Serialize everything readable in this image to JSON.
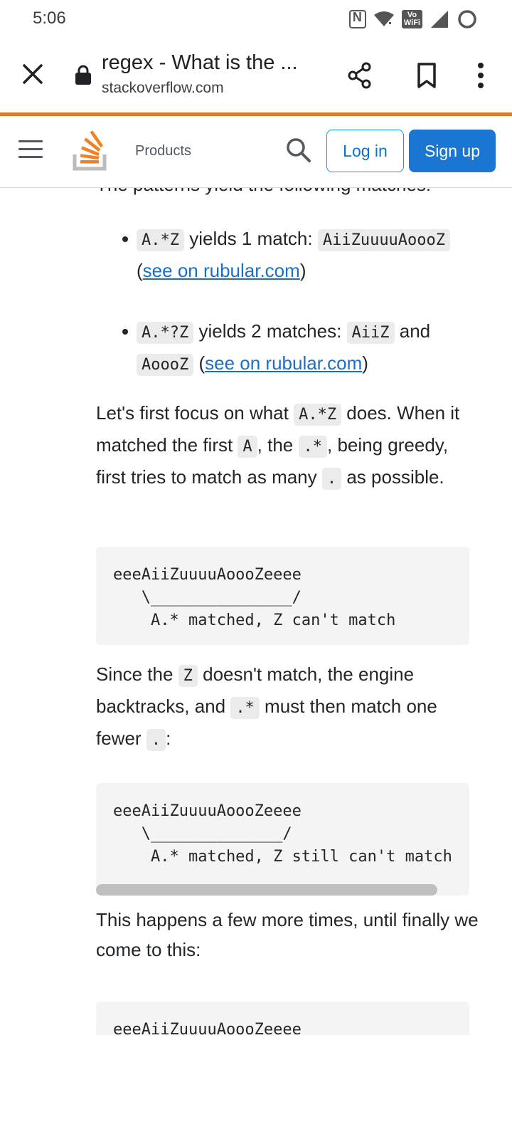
{
  "status": {
    "time": "5:06",
    "vowifi_top": "Vo",
    "vowifi_bottom": "WiFi"
  },
  "browser": {
    "title": "regex - What is the ...",
    "domain": "stackoverflow.com"
  },
  "header": {
    "products": "Products",
    "login": "Log in",
    "signup": "Sign up",
    "accent": "#e87922"
  },
  "content": {
    "cut_line": "The patterns yield the following matches:",
    "bullet1": {
      "code1": "A.*Z",
      "text1": " yields 1 match: ",
      "code2": "AiiZuuuuAoooZ",
      "text2": " (",
      "link": "see on rubular.com",
      "text3": ")"
    },
    "bullet2": {
      "code1": "A.*?Z",
      "text1": " yields 2 matches: ",
      "code2": "AiiZ",
      "text2": " and ",
      "code3": "AoooZ",
      "text3": " (",
      "link": "see on rubular.com",
      "text4": ")"
    },
    "para1": {
      "t1": "Let's first focus on what ",
      "c1": "A.*Z",
      "t2": " does. When it matched the first ",
      "c2": "A",
      "t3": ", the ",
      "c3": ".*",
      "t4": ", being greedy, first tries to match as many ",
      "c4": ".",
      "t5": " as possible."
    },
    "code_block1": "eeeAiiZuuuuAoooZeeee\n   \\_______________/\n    A.* matched, Z can't match",
    "para2": {
      "t1": "Since the ",
      "c1": "Z",
      "t2": " doesn't match, the engine backtracks, and ",
      "c2": ".*",
      "t3": " must then match one fewer ",
      "c3": ".",
      "t4": ":"
    },
    "code_block2": "eeeAiiZuuuuAoooZeeee\n   \\______________/\n    A.* matched, Z still can't match",
    "para3": "This happens a few more times, until finally we come to this:",
    "code_block3": "eeeAiiZuuuuAoooZeeee"
  }
}
